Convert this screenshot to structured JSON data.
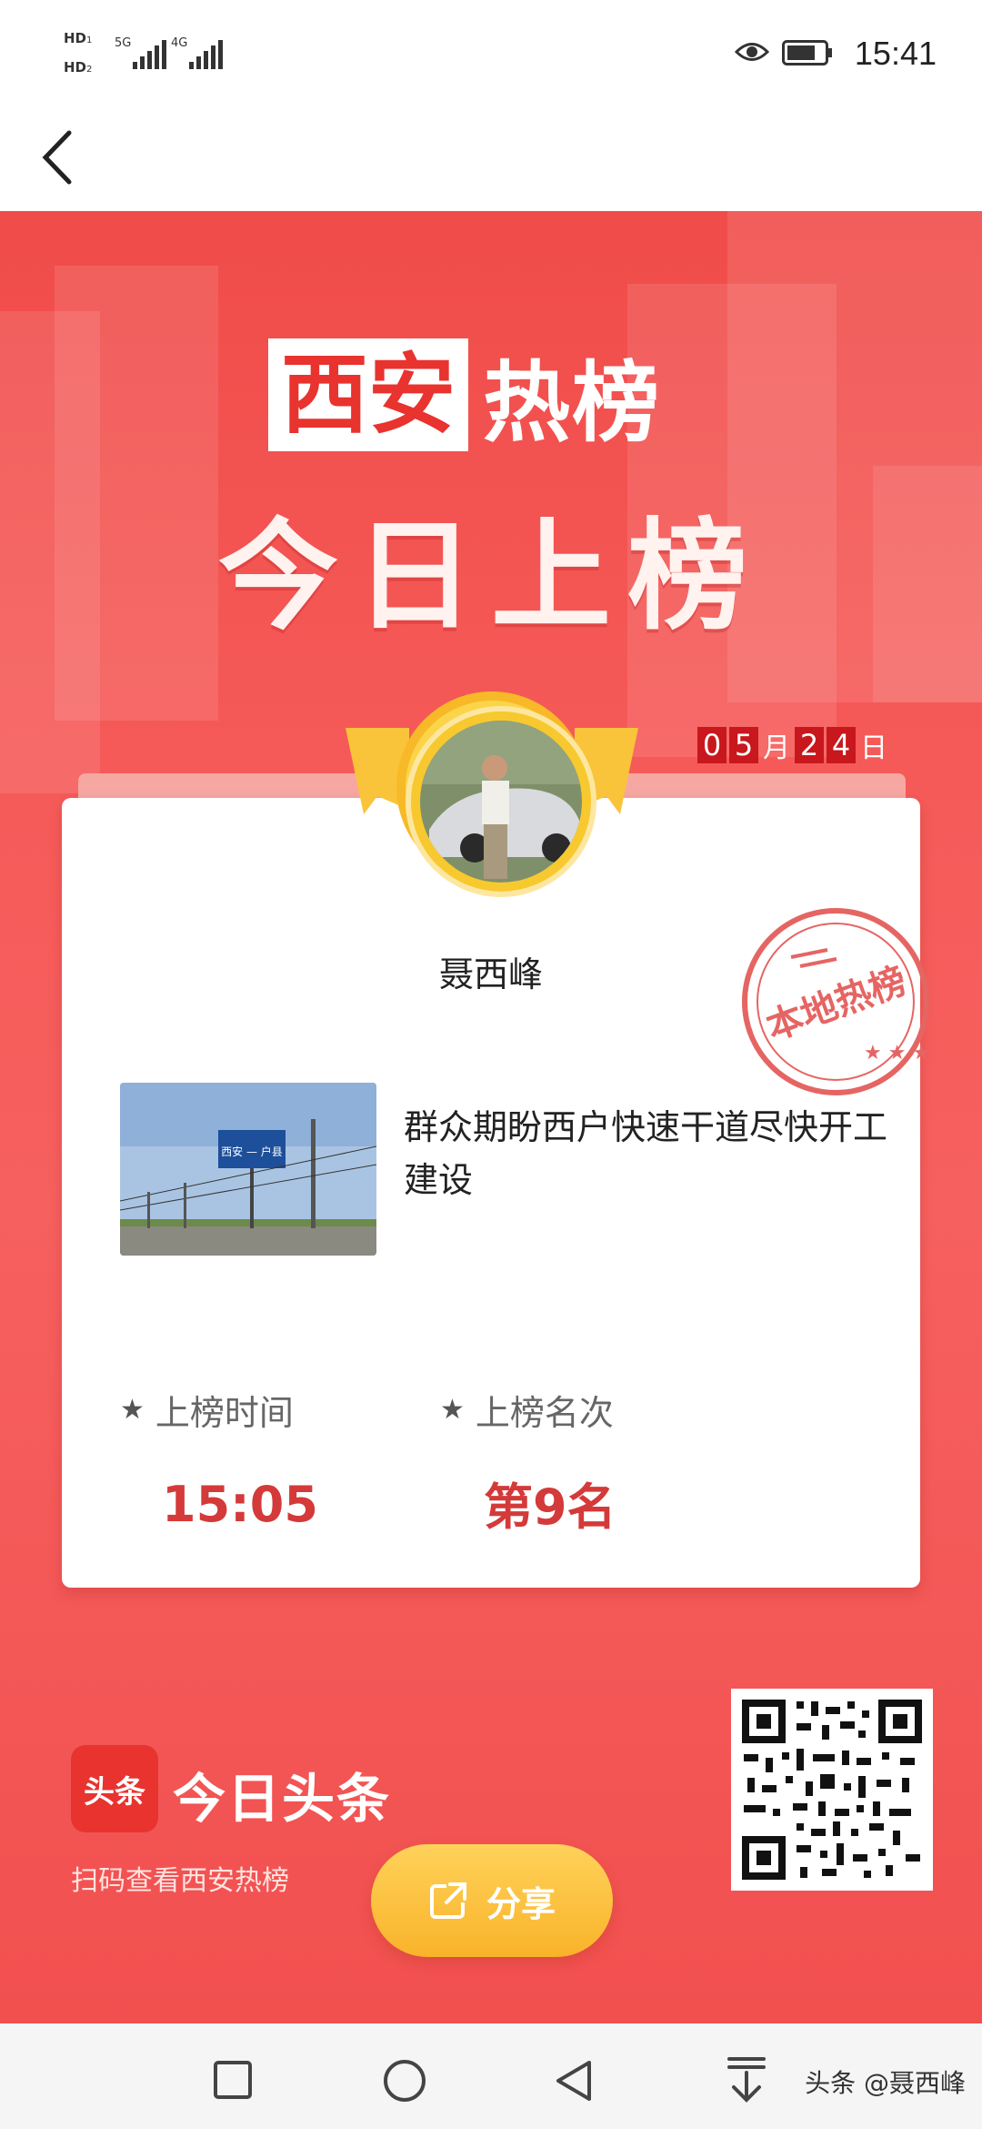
{
  "status_bar": {
    "hd1": "HD",
    "hd1_sub": "1",
    "hd2": "HD",
    "hd2_sub": "2",
    "net1": "5G",
    "net2": "4G",
    "time": "15:41",
    "icons": [
      "eye-icon",
      "battery-icon",
      "signal-icon"
    ]
  },
  "nav": {
    "back_icon": "chevron-left-icon"
  },
  "poster": {
    "city": "西安",
    "hot_list": "热榜",
    "headline": "今日上榜",
    "date": {
      "month_digits": [
        "0",
        "5"
      ],
      "month_unit": "月",
      "day_digits": [
        "2",
        "4"
      ],
      "day_unit": "日"
    },
    "stamp_text": "本地热榜",
    "user_name": "聂西峰",
    "article_title": "群众期盼西户快速干道尽快开工建设",
    "thumbnail_sign_text": "西安 — 户县",
    "rank_time_label": "上榜时间",
    "rank_time_value": "15:05",
    "rank_position_label": "上榜名次",
    "rank_position_value": "第9名",
    "app_logo_text": "头条",
    "app_name": "今日头条",
    "scan_hint": "扫码查看西安热榜",
    "share_label": "分享"
  },
  "system_nav": {
    "icons": [
      "square-recent-icon",
      "circle-home-icon",
      "triangle-back-icon",
      "download-arrow-icon"
    ],
    "watermark": "头条 @聂西峰"
  },
  "colors": {
    "poster_red": "#f05553",
    "accent_red": "#d33a39",
    "gold": "#f7c92f",
    "date_box": "#c8171d"
  }
}
